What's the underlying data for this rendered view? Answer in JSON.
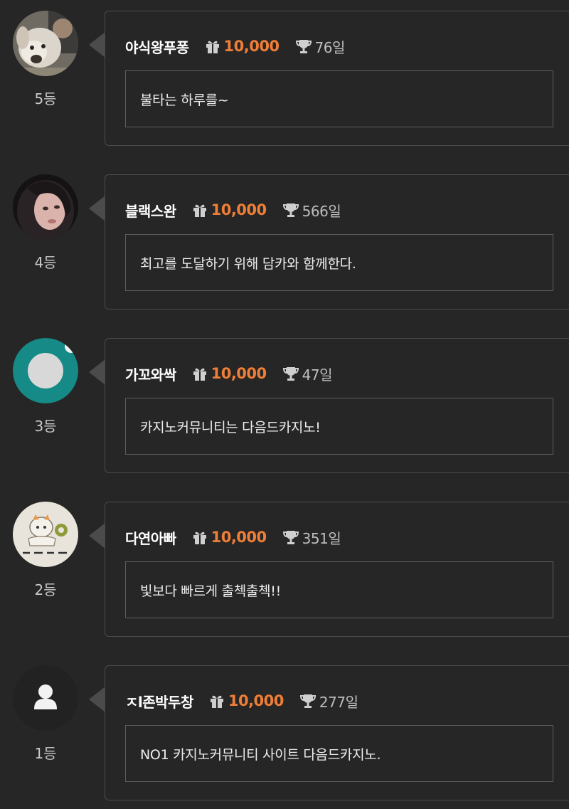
{
  "colors": {
    "background": "#262626",
    "card_border": "#4b4b4b",
    "points": "#f07e36",
    "nickname": "#ffffff"
  },
  "icons": {
    "gift": "gift-icon",
    "trophy": "trophy-icon",
    "default_avatar": "user-icon"
  },
  "entries": [
    {
      "rank": "5등",
      "nickname": "야식왕푸퐁",
      "points": "10,000",
      "days": "76일",
      "message": "불타는 하루를~",
      "avatar": "photo-dog"
    },
    {
      "rank": "4등",
      "nickname": "블랙스완",
      "points": "10,000",
      "days": "566일",
      "message": "최고를 도달하기 위해 담카와 함께한다.",
      "avatar": "photo-person"
    },
    {
      "rank": "3등",
      "nickname": "가꼬와싹",
      "points": "10,000",
      "days": "47일",
      "message": "카지노커뮤니티는 다음드카지노!",
      "avatar": "teal-circle"
    },
    {
      "rank": "2등",
      "nickname": "다연아빠",
      "points": "10,000",
      "days": "351일",
      "message": "빛보다 빠르게 출첵출첵!!",
      "avatar": "photo-drawing"
    },
    {
      "rank": "1등",
      "nickname": "ㅈl존박두창",
      "points": "10,000",
      "days": "277일",
      "message": "NO1 카지노커뮤니티 사이트 다음드카지노.",
      "avatar": "default-user"
    }
  ]
}
